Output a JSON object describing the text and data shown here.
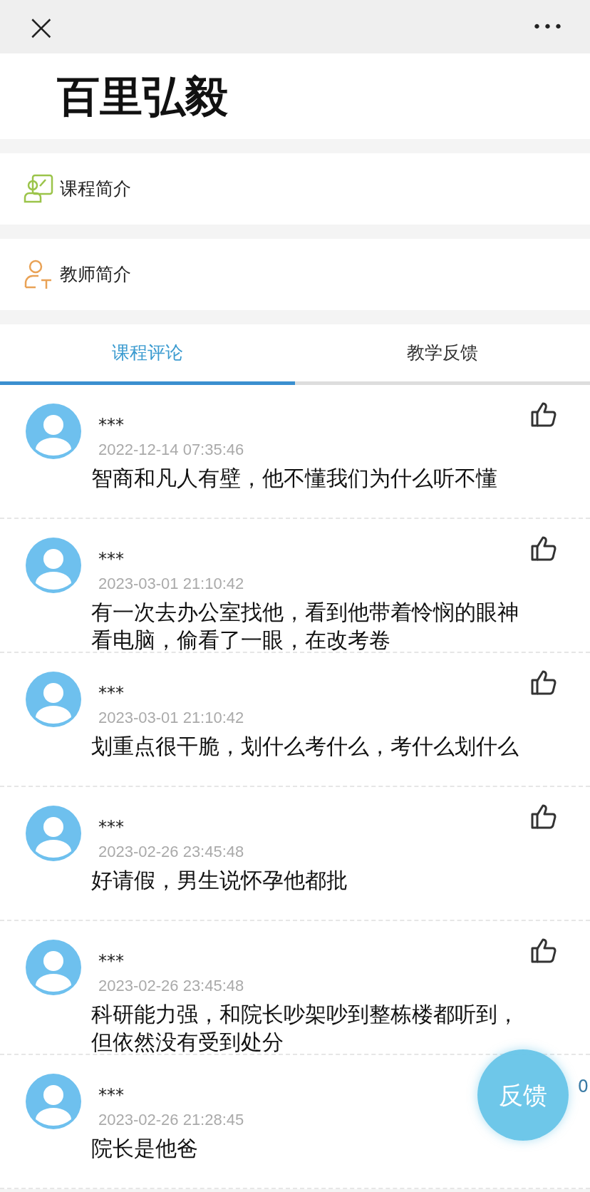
{
  "top_bar": {
    "close": "×",
    "more": "•••"
  },
  "title": "百里弘毅",
  "menu_items": [
    {
      "kind": "course",
      "label": "课程简介"
    },
    {
      "kind": "teacher",
      "label": "教师简介"
    }
  ],
  "tabs": [
    {
      "label": "课程评论",
      "selected": true
    },
    {
      "label": "教学反馈",
      "selected": false
    }
  ],
  "comments": [
    {
      "name": "***",
      "time": "2022-12-14 07:35:46",
      "text": "智商和凡人有壁，他不懂我们为什么听不懂"
    },
    {
      "name": "***",
      "time": "2023-03-01 21:10:42",
      "text": "有一次去办公室找他，看到他带着怜悯的眼神看电脑，偷看了一眼，在改考卷"
    },
    {
      "name": "***",
      "time": "2023-03-01 21:10:42",
      "text": "划重点很干脆，划什么考什么，考什么划什么"
    },
    {
      "name": "***",
      "time": "2023-02-26 23:45:48",
      "text": "好请假，男生说怀孕他都批"
    },
    {
      "name": "***",
      "time": "2023-02-26 23:45:48",
      "text": "科研能力强，和院长吵架吵到整栋楼都听到，但依然没有受到处分"
    },
    {
      "name": "***",
      "time": "2023-02-26 21:28:45",
      "text": "院长是他爸",
      "like_icon": false,
      "likes": "0"
    }
  ],
  "feedback_button": "反馈"
}
